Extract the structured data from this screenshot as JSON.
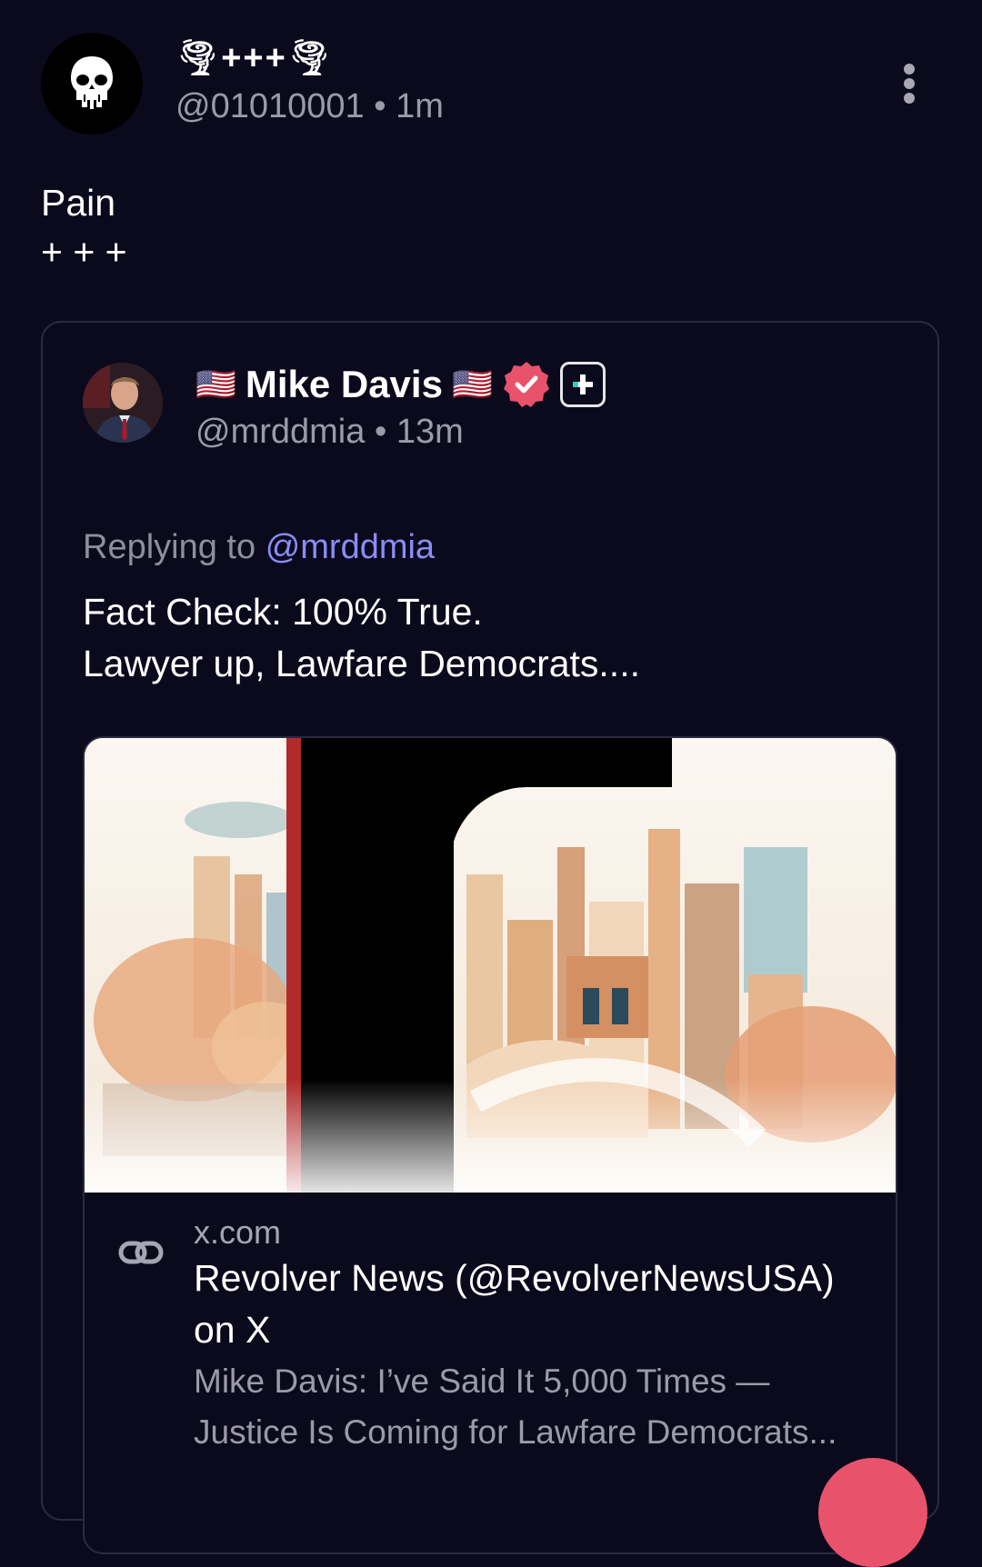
{
  "post": {
    "author_display_name": "🌪+++🌪",
    "author_handle": "@01010001",
    "separator": "•",
    "time_ago": "1m",
    "text": "Pain\n+ + +",
    "more_icon": "more-vertical-icon",
    "avatar_icon": "skull-icon"
  },
  "quote": {
    "author_name": "Mike Davis",
    "flag_left": "🇺🇸",
    "flag_right": "🇺🇸",
    "verified_icon": "verified-badge-icon",
    "plus_badge_icon": "plus-badge-icon",
    "author_handle": "@mrddmia",
    "separator": "•",
    "time_ago": "13m",
    "replying_prefix": "Replying to",
    "replying_mention": "@mrddmia",
    "text": "Fact Check: 100% True.\nLawyer up, Lawfare Democrats....",
    "link_card": {
      "domain": "x.com",
      "title": "Revolver News (@RevolverNewsUSA) on X",
      "description": "Mike Davis: I’ve Said It 5,000 Times — Justice Is Coming for Lawfare Democrats...",
      "link_icon": "link-icon",
      "image_alt": "Revolver News logo over illustrated cityscape"
    }
  },
  "colors": {
    "background": "#0b0a1d",
    "muted_text": "#9b9aa8",
    "mention": "#8b8cf5",
    "verified": "#e8536b",
    "card_border": "#2a2a40"
  }
}
